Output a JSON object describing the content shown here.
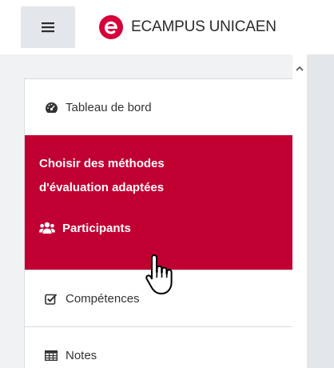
{
  "header": {
    "menu_icon": "hamburger-icon",
    "brand_logo": "ecampus-e-logo",
    "brand_name": "ECAMPUS UNICAEN",
    "brand_color": "#c10032"
  },
  "nav": {
    "items": [
      {
        "label": "Tableau de bord",
        "icon": "dashboard-gauge-icon"
      },
      {
        "label": "Compétences",
        "icon": "checkbox-icon"
      },
      {
        "label": "Notes",
        "icon": "table-icon"
      }
    ],
    "active_section": {
      "title_line1": "Choisir des méthodes",
      "title_line2": "d'évaluation adaptées",
      "item_label": "Participants",
      "item_icon": "users-icon",
      "background": "#c10032"
    }
  },
  "scrollbar": {
    "up_arrow": "chevron-up-icon"
  },
  "cursor": "hand-pointer-cursor"
}
